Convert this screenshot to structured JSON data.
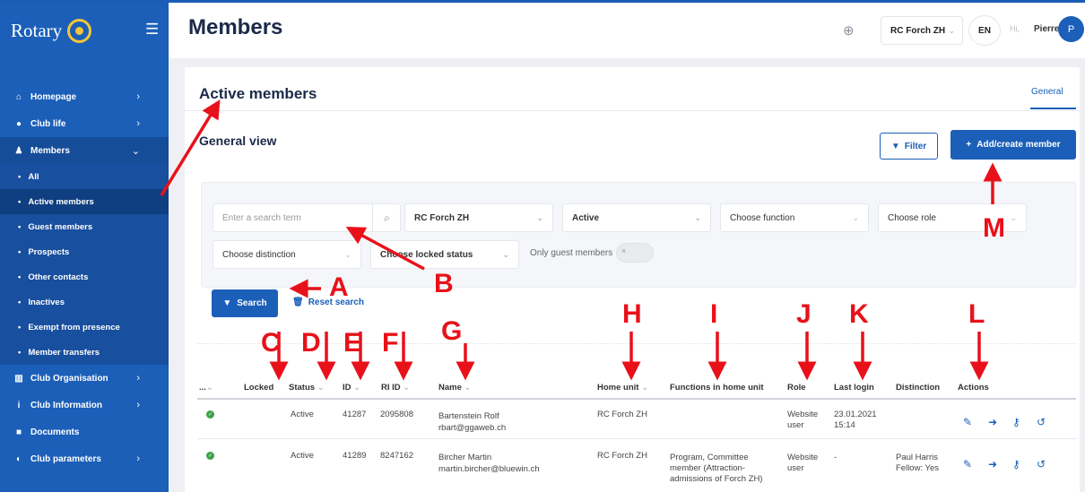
{
  "sidebar": {
    "logo_text": "Rotary",
    "menu_icon": "menu-icon",
    "items": [
      {
        "label": "Homepage",
        "icon": "home-icon",
        "chevron": "›"
      },
      {
        "label": "Club life",
        "icon": "globe-icon",
        "chevron": "›"
      },
      {
        "label": "Members",
        "icon": "user-icon",
        "chevron": "⌄"
      }
    ],
    "subitems": [
      {
        "label": "All"
      },
      {
        "label": "Active members"
      },
      {
        "label": "Guest members"
      },
      {
        "label": "Prospects"
      },
      {
        "label": "Other contacts"
      },
      {
        "label": "Inactives"
      },
      {
        "label": "Exempt from presence"
      },
      {
        "label": "Member transfers"
      }
    ],
    "items_bottom": [
      {
        "label": "Club Organisation",
        "icon": "building-icon",
        "chevron": "›"
      },
      {
        "label": "Club Information",
        "icon": "info-icon",
        "chevron": "›"
      },
      {
        "label": "Documents",
        "icon": "folder-icon",
        "chevron": ""
      },
      {
        "label": "Club parameters",
        "icon": "toggle-icon",
        "chevron": "›"
      }
    ]
  },
  "topbar": {
    "title": "Members",
    "club": "RC Forch ZH",
    "lang": "EN",
    "greeting": "Hi,",
    "user": "Pierre",
    "avatar": "P"
  },
  "panel": {
    "title": "Active members",
    "tab": "General",
    "subtitle": "General view",
    "filter_button": "Filter",
    "add_button": "Add/create member"
  },
  "filters": {
    "search_placeholder": "Enter a search term",
    "club": "RC Forch ZH",
    "status": "Active",
    "function": "Choose function",
    "role": "Choose role",
    "distinction": "Choose distinction",
    "locked": "Choose locked status",
    "guest_label": "Only guest members",
    "search_button": "Search",
    "reset_button": "Reset search"
  },
  "table": {
    "headers": {
      "dots": "...",
      "locked": "Locked",
      "status": "Status",
      "id": "ID",
      "riid": "RI ID",
      "name": "Name",
      "home_unit": "Home unit",
      "functions": "Functions in home unit",
      "role": "Role",
      "last_login": "Last login",
      "distinction": "Distinction",
      "actions": "Actions"
    },
    "rows": [
      {
        "status": "Active",
        "id": "41287",
        "riid": "2095808",
        "name": "Bartenstein Rolf",
        "email": "rbart@ggaweb.ch",
        "home_unit": "RC Forch ZH",
        "functions": "",
        "role": "Website user",
        "last_login": "23.01.2021 15:14",
        "distinction": ""
      },
      {
        "status": "Active",
        "id": "41289",
        "riid": "8247162",
        "name": "Bircher Martin",
        "email": "martin.bircher@bluewin.ch",
        "home_unit": "RC Forch ZH",
        "functions": "Program, Committee member (Attraction-admissions of Forch ZH)",
        "role": "Website user",
        "last_login": "-",
        "distinction": "Paul Harris Fellow: Yes"
      }
    ]
  },
  "annotations": {
    "labels": [
      "A",
      "B",
      "C",
      "D",
      "E",
      "F",
      "G",
      "H",
      "I",
      "J",
      "K",
      "L",
      "M"
    ],
    "color": "#e8111a"
  },
  "colors": {
    "primary": "#1b5fb8",
    "sidebar": "#1b5fb8",
    "active": "#3fa14b"
  }
}
